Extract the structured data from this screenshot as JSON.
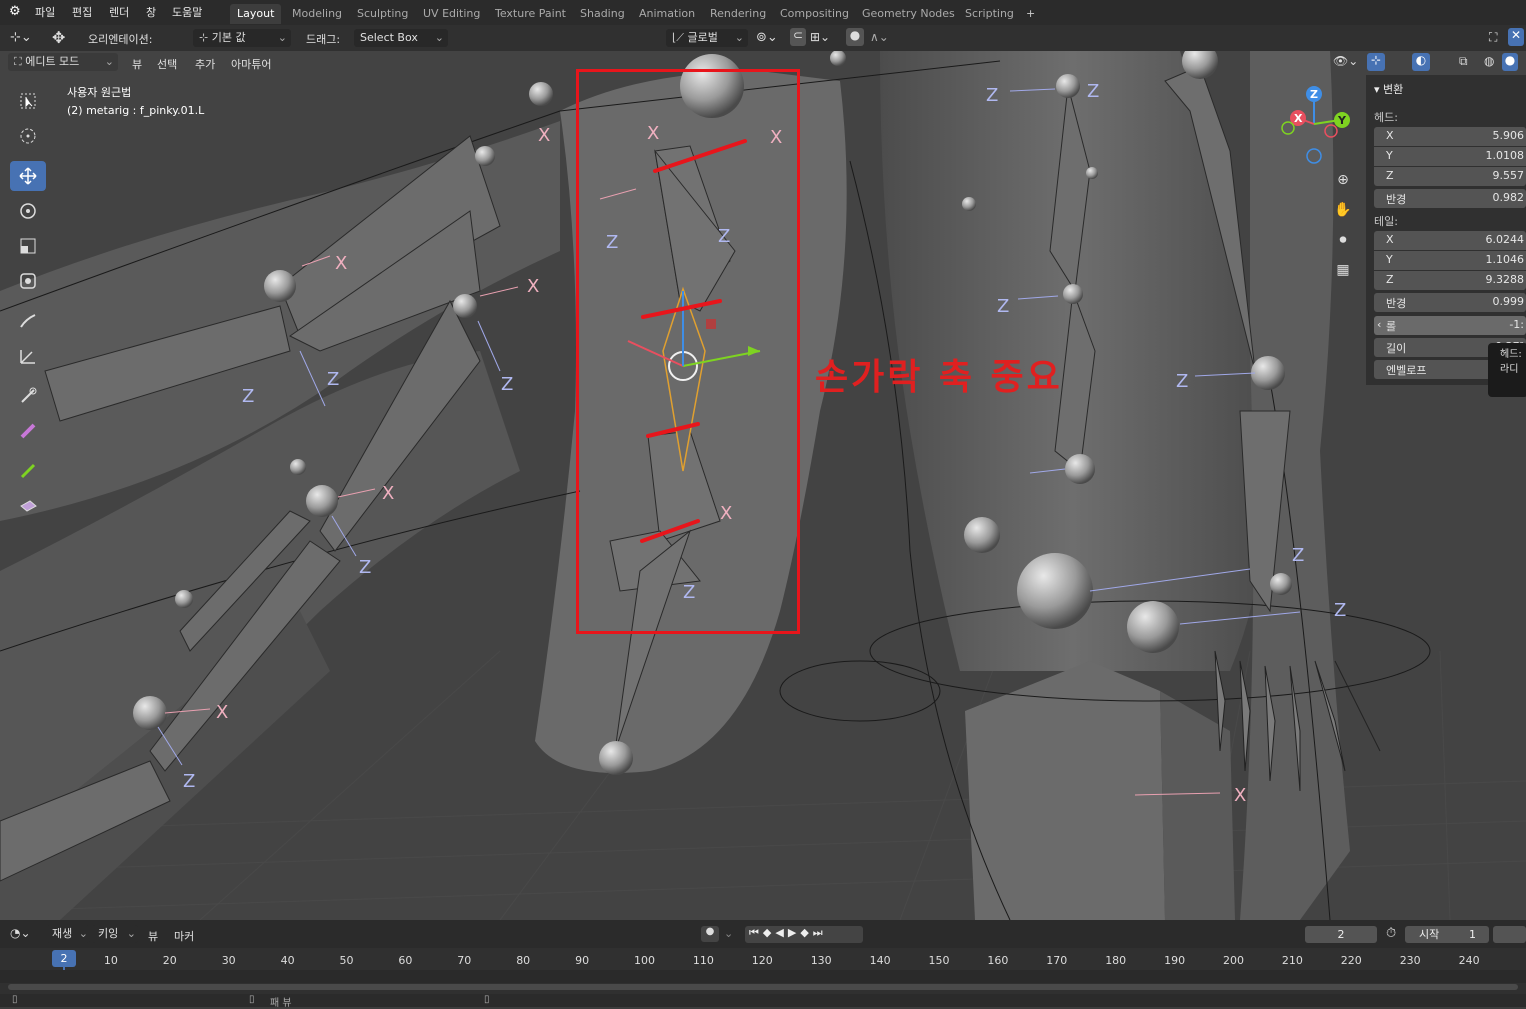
{
  "topbar": {
    "menus": [
      "파일",
      "편집",
      "렌더",
      "창",
      "도움말"
    ],
    "workspaces": [
      "Layout",
      "Modeling",
      "Sculpting",
      "UV Editing",
      "Texture Paint",
      "Shading",
      "Animation",
      "Rendering",
      "Compositing",
      "Geometry Nodes",
      "Scripting",
      "+"
    ],
    "active_workspace": "Layout"
  },
  "toolbar": {
    "orientation_label": "오리엔테이션:",
    "orientation_value": "기본 값",
    "drag_label": "드래그:",
    "drag_value": "Select Box",
    "transform_orientation": "글로벌"
  },
  "header2": {
    "mode": "에디트 모드",
    "menus": [
      "뷰",
      "선택",
      "추가",
      "아마튜어"
    ]
  },
  "viewport": {
    "view_name": "사용자 원근법",
    "object_info": "(2) metarig : f_pinky.01.L",
    "annotation": "손가락 축 중요",
    "axis_labels": {
      "x": "X",
      "z": "Z"
    }
  },
  "gizmo": {
    "x": "X",
    "y": "Y",
    "z": "Z"
  },
  "n_panel": {
    "section": "변환",
    "head_label": "헤드:",
    "head": [
      {
        "axis": "X",
        "value": "5.906"
      },
      {
        "axis": "Y",
        "value": "1.0108"
      },
      {
        "axis": "Z",
        "value": "9.557"
      }
    ],
    "head_radius_label": "반경",
    "head_radius": "0.982",
    "tail_label": "테일:",
    "tail": [
      {
        "axis": "X",
        "value": "6.0244"
      },
      {
        "axis": "Y",
        "value": "1.1046"
      },
      {
        "axis": "Z",
        "value": "9.3288"
      }
    ],
    "tail_radius_label": "반경",
    "tail_radius": "0.999",
    "roll_label": "롤",
    "roll_value": "-1:",
    "length_label": "길이",
    "length_value": "0.27²",
    "envelope_label": "엔벨로프"
  },
  "tooltip": {
    "line1": "헤드:",
    "line2": "라디"
  },
  "timeline": {
    "menus": [
      "재생",
      "키잉",
      "뷰",
      "마커"
    ],
    "current_frame": "2",
    "start_label": "시작",
    "start_value": "1",
    "ticks": [
      "10",
      "20",
      "30",
      "40",
      "50",
      "60",
      "70",
      "80",
      "90",
      "100",
      "110",
      "120",
      "130",
      "140",
      "150",
      "160",
      "170",
      "180",
      "190",
      "200",
      "210",
      "220",
      "230",
      "240"
    ],
    "status": "패 뷰"
  },
  "colors": {
    "accent": "#4772b3",
    "annotation": "#e8151b",
    "axis_x": "#e84f5f",
    "axis_y": "#8cc540",
    "axis_z": "#3f8ee6"
  }
}
